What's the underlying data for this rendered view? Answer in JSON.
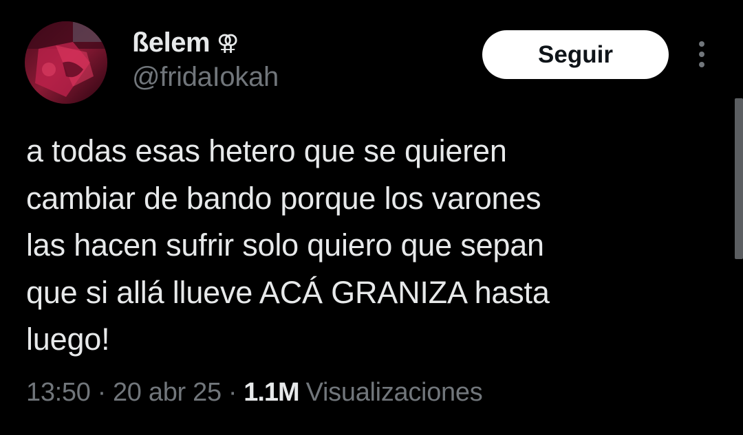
{
  "tweet": {
    "author": {
      "display_name": "ßelem",
      "name_emoji": "⚢",
      "handle": "@fridaIokah",
      "avatar_icon": "profile-avatar"
    },
    "follow_label": "Seguir",
    "more_icon": "more-options-vertical",
    "text": "a todas esas hetero que se quieren\ncambiar de bando porque los varones\nlas hacen sufrir solo quiero que sepan\nque si allá llueve ACÁ GRANIZA hasta\nluego!",
    "meta": {
      "time": "13:50",
      "separator": "·",
      "date": "20 abr 25",
      "views_count": "1.1M",
      "views_label": "Visualizaciones"
    }
  },
  "colors": {
    "background": "#000000",
    "primary_text": "#e7e9ea",
    "secondary_text": "#71767b",
    "follow_button_bg": "#ffffff",
    "follow_button_text": "#0f1419"
  }
}
